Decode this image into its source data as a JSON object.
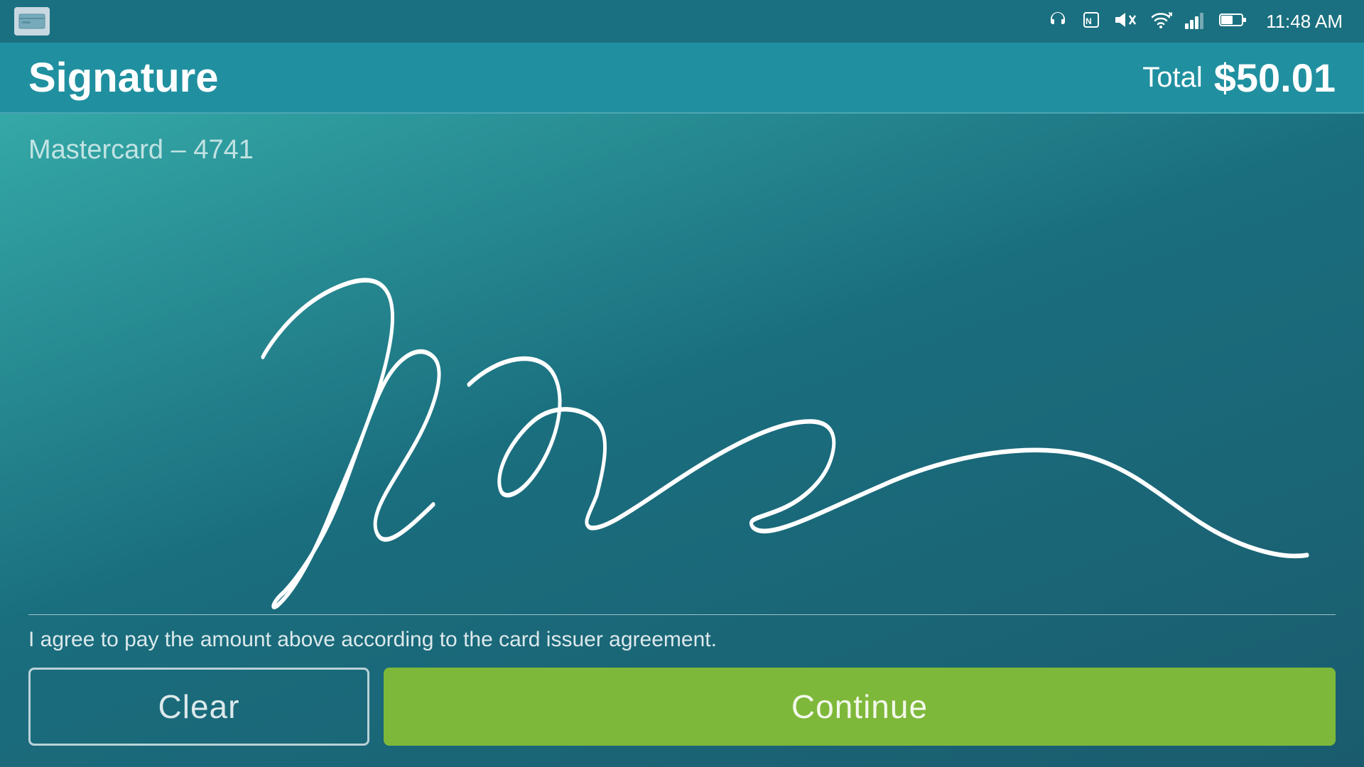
{
  "status_bar": {
    "time": "11:48 AM",
    "icons": [
      "headset",
      "nfc",
      "mute",
      "wifi",
      "signal",
      "battery"
    ]
  },
  "header": {
    "title": "Signature",
    "total_label": "Total",
    "total_amount": "$50.01"
  },
  "signature_area": {
    "card_label": "Mastercard  – 4741",
    "agreement_text": "I agree to pay the amount above according to the card issuer agreement."
  },
  "buttons": {
    "clear_label": "Clear",
    "continue_label": "Continue"
  }
}
